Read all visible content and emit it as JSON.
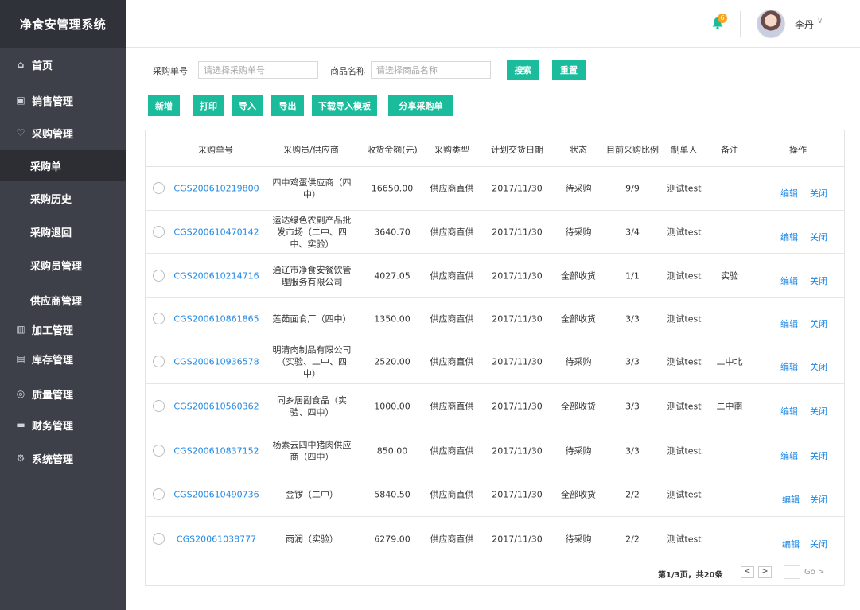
{
  "app": {
    "title": "净食安管理系统"
  },
  "sidebar": {
    "items": [
      {
        "label": "首页",
        "icon": "home-icon"
      },
      {
        "label": "销售管理",
        "icon": "sales-icon"
      },
      {
        "label": "采购管理",
        "icon": "purchase-icon"
      },
      {
        "label": "采购单",
        "sub": true,
        "active": true
      },
      {
        "label": "采购历史",
        "sub": true
      },
      {
        "label": "采购退回",
        "sub": true
      },
      {
        "label": "采购员管理",
        "sub": true
      },
      {
        "label": "供应商管理",
        "sub": true
      },
      {
        "label": "加工管理",
        "icon": "processing-icon"
      },
      {
        "label": "库存管理",
        "icon": "inventory-icon"
      },
      {
        "label": "质量管理",
        "icon": "quality-icon"
      },
      {
        "label": "财务管理",
        "icon": "finance-icon"
      },
      {
        "label": "系统管理",
        "icon": "settings-icon"
      }
    ]
  },
  "header": {
    "notification_count": "6",
    "user_name": "李丹",
    "chevron": "∨"
  },
  "filters": {
    "order_no_label": "采购单号",
    "order_no_placeholder": "请选择采购单号",
    "product_label": "商品名称",
    "product_placeholder": "请选择商品名称",
    "search_label": "搜索",
    "reset_label": "重置"
  },
  "toolbar": {
    "new_label": "新增",
    "print_label": "打印",
    "import_label": "导入",
    "export_label": "导出",
    "download_template_label": "下载导入模板",
    "share_label": "分享采购单"
  },
  "table": {
    "columns": [
      "采购单号",
      "采购员/供应商",
      "收货金额(元)",
      "采购类型",
      "计划交货日期",
      "状态",
      "目前采购比例",
      "制单人",
      "备注",
      "操作"
    ],
    "rows": [
      {
        "order_no": "CGS200610219800",
        "supplier": "四中鸡蛋供应商（四中）",
        "amount": "16650.00",
        "type": "供应商直供",
        "date": "2017/11/30",
        "status": "待采购",
        "ratio": "9/9",
        "creator": "测试test",
        "note": "",
        "edit": "编辑",
        "close": "关闭"
      },
      {
        "order_no": "CGS200610470142",
        "supplier": "运达绿色农副产品批发市场（二中、四中、实验）",
        "amount": "3640.70",
        "type": "供应商直供",
        "date": "2017/11/30",
        "status": "待采购",
        "ratio": "3/4",
        "creator": "测试test",
        "note": "",
        "edit": "编辑",
        "close": "关闭"
      },
      {
        "order_no": "CGS200610214716",
        "supplier": "通辽市净食安餐饮管理服务有限公司",
        "amount": "4027.05",
        "type": "供应商直供",
        "date": "2017/11/30",
        "status": "全部收货",
        "ratio": "1/1",
        "creator": "测试test",
        "note": "实验",
        "edit": "编辑",
        "close": "关闭"
      },
      {
        "order_no": "CGS200610861865",
        "supplier": "莲茹面食厂（四中）",
        "amount": "1350.00",
        "type": "供应商直供",
        "date": "2017/11/30",
        "status": "全部收货",
        "ratio": "3/3",
        "creator": "测试test",
        "note": "",
        "edit": "编辑",
        "close": "关闭"
      },
      {
        "order_no": "CGS200610936578",
        "supplier": "明清肉制品有限公司（实验、二中、四中）",
        "amount": "2520.00",
        "type": "供应商直供",
        "date": "2017/11/30",
        "status": "待采购",
        "ratio": "3/3",
        "creator": "测试test",
        "note": "二中北",
        "edit": "编辑",
        "close": "关闭"
      },
      {
        "order_no": "CGS200610560362",
        "supplier": "同乡居副食品（实验、四中）",
        "amount": "1000.00",
        "type": "供应商直供",
        "date": "2017/11/30",
        "status": "全部收货",
        "ratio": "3/3",
        "creator": "测试test",
        "note": "二中南",
        "edit": "编辑",
        "close": "关闭"
      },
      {
        "order_no": "CGS200610837152",
        "supplier": "杨素云四中猪肉供应商（四中）",
        "amount": "850.00",
        "type": "供应商直供",
        "date": "2017/11/30",
        "status": "待采购",
        "ratio": "3/3",
        "creator": "测试test",
        "note": "",
        "edit": "编辑",
        "close": "关闭"
      },
      {
        "order_no": "CGS200610490736",
        "supplier": "金锣（二中）",
        "amount": "5840.50",
        "type": "供应商直供",
        "date": "2017/11/30",
        "status": "全部收货",
        "ratio": "2/2",
        "creator": "测试test",
        "note": "",
        "edit": "编辑",
        "close": "关闭"
      },
      {
        "order_no": "CGS20061038777",
        "supplier": "雨润（实验）",
        "amount": "6279.00",
        "type": "供应商直供",
        "date": "2017/11/30",
        "status": "待采购",
        "ratio": "2/2",
        "creator": "测试test",
        "note": "",
        "edit": "编辑",
        "close": "关闭"
      }
    ]
  },
  "pagination": {
    "summary": "第1/3页，共20条",
    "prev": "<",
    "next": ">",
    "go_label": "Go >"
  },
  "colors": {
    "accent": "#1abc9c",
    "link": "#1e88e5",
    "sidebar_bg": "#3d4048",
    "badge": "#f5a623"
  }
}
